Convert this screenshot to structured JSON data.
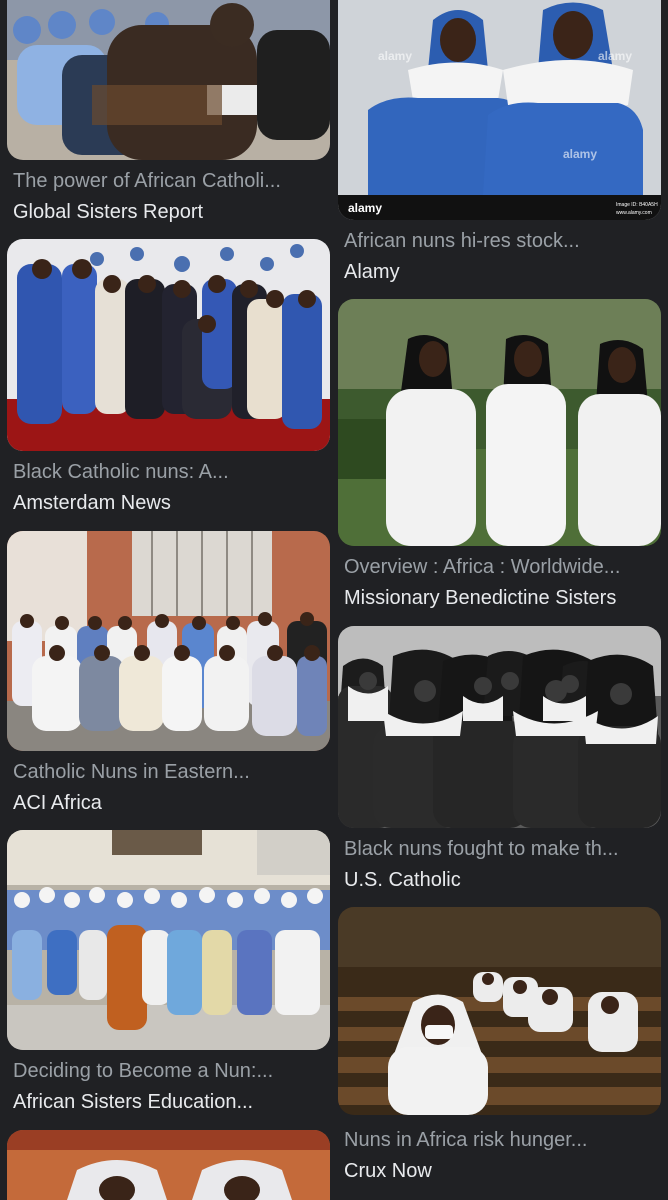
{
  "results": [
    {
      "title": "The power of African Catholi...",
      "source": "Global Sisters Report"
    },
    {
      "title": "African nuns hi-res stock...",
      "source": "Alamy",
      "watermark": "alamy",
      "banner": "alamy",
      "image_id": "Image ID: B40A5H",
      "site": "www.alamy.com"
    },
    {
      "title": "Black Catholic nuns: A...",
      "source": "Amsterdam News"
    },
    {
      "title": "Overview : Africa : Worldwide...",
      "source": "Missionary Benedictine Sisters"
    },
    {
      "title": "Catholic Nuns in Eastern...",
      "source": "ACI Africa"
    },
    {
      "title": "Black nuns fought to make th...",
      "source": "U.S. Catholic"
    },
    {
      "title": "Deciding to Become a Nun:...",
      "source": "African Sisters Education..."
    },
    {
      "title": "Nuns in Africa risk hunger...",
      "source": "Crux Now"
    },
    {
      "title": "",
      "source": ""
    }
  ],
  "colors": {
    "background": "#202124",
    "title": "#9aa0a6",
    "source": "#e8eaed",
    "habit_blue": "#2f5fb0",
    "veil_white": "#f2f2f2"
  }
}
